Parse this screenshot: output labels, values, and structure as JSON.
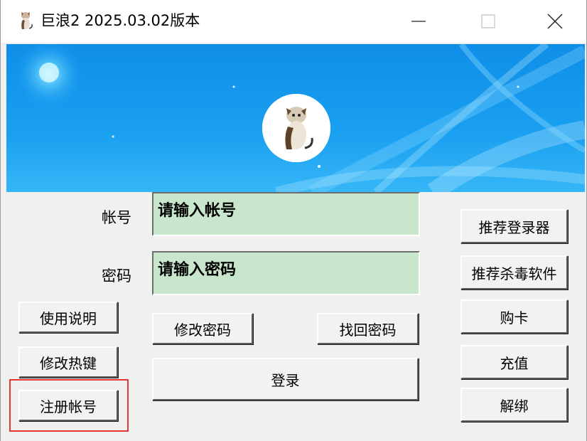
{
  "window": {
    "title": "巨浪2 2025.03.02版本"
  },
  "form": {
    "account_label": "帐号",
    "account_value": "请输入帐号",
    "password_label": "密码",
    "password_value": "请输入密码"
  },
  "buttons": {
    "instructions": "使用说明",
    "modify_hotkey": "修改热键",
    "register": "注册帐号",
    "change_password": "修改密码",
    "recover_password": "找回密码",
    "login": "登录",
    "recommend_login": "推荐登录器",
    "recommend_antivirus": "推荐杀毒软件",
    "buy_card": "购卡",
    "recharge": "充值",
    "unbind": "解绑"
  },
  "colors": {
    "banner_blue": "#1e90ff",
    "field_green": "#c8e6cb",
    "highlight_red": "#e53935"
  }
}
